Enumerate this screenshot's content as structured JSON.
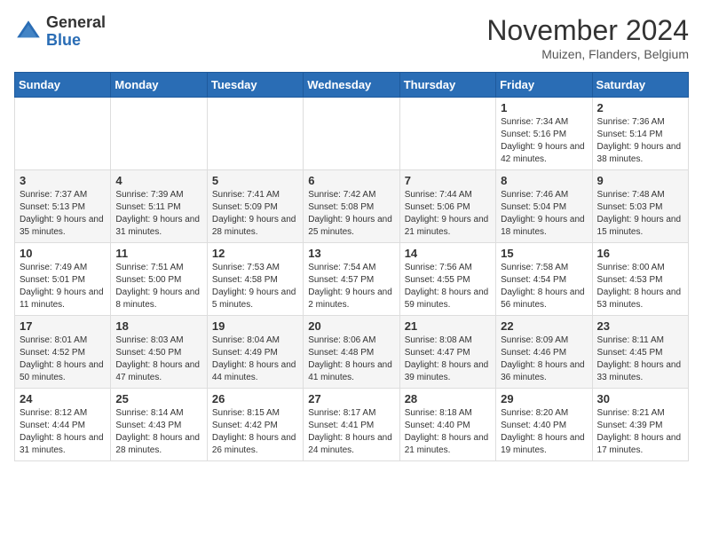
{
  "header": {
    "logo_general": "General",
    "logo_blue": "Blue",
    "month_title": "November 2024",
    "location": "Muizen, Flanders, Belgium"
  },
  "days_of_week": [
    "Sunday",
    "Monday",
    "Tuesday",
    "Wednesday",
    "Thursday",
    "Friday",
    "Saturday"
  ],
  "weeks": [
    [
      {
        "num": "",
        "info": ""
      },
      {
        "num": "",
        "info": ""
      },
      {
        "num": "",
        "info": ""
      },
      {
        "num": "",
        "info": ""
      },
      {
        "num": "",
        "info": ""
      },
      {
        "num": "1",
        "info": "Sunrise: 7:34 AM\nSunset: 5:16 PM\nDaylight: 9 hours and 42 minutes."
      },
      {
        "num": "2",
        "info": "Sunrise: 7:36 AM\nSunset: 5:14 PM\nDaylight: 9 hours and 38 minutes."
      }
    ],
    [
      {
        "num": "3",
        "info": "Sunrise: 7:37 AM\nSunset: 5:13 PM\nDaylight: 9 hours and 35 minutes."
      },
      {
        "num": "4",
        "info": "Sunrise: 7:39 AM\nSunset: 5:11 PM\nDaylight: 9 hours and 31 minutes."
      },
      {
        "num": "5",
        "info": "Sunrise: 7:41 AM\nSunset: 5:09 PM\nDaylight: 9 hours and 28 minutes."
      },
      {
        "num": "6",
        "info": "Sunrise: 7:42 AM\nSunset: 5:08 PM\nDaylight: 9 hours and 25 minutes."
      },
      {
        "num": "7",
        "info": "Sunrise: 7:44 AM\nSunset: 5:06 PM\nDaylight: 9 hours and 21 minutes."
      },
      {
        "num": "8",
        "info": "Sunrise: 7:46 AM\nSunset: 5:04 PM\nDaylight: 9 hours and 18 minutes."
      },
      {
        "num": "9",
        "info": "Sunrise: 7:48 AM\nSunset: 5:03 PM\nDaylight: 9 hours and 15 minutes."
      }
    ],
    [
      {
        "num": "10",
        "info": "Sunrise: 7:49 AM\nSunset: 5:01 PM\nDaylight: 9 hours and 11 minutes."
      },
      {
        "num": "11",
        "info": "Sunrise: 7:51 AM\nSunset: 5:00 PM\nDaylight: 9 hours and 8 minutes."
      },
      {
        "num": "12",
        "info": "Sunrise: 7:53 AM\nSunset: 4:58 PM\nDaylight: 9 hours and 5 minutes."
      },
      {
        "num": "13",
        "info": "Sunrise: 7:54 AM\nSunset: 4:57 PM\nDaylight: 9 hours and 2 minutes."
      },
      {
        "num": "14",
        "info": "Sunrise: 7:56 AM\nSunset: 4:55 PM\nDaylight: 8 hours and 59 minutes."
      },
      {
        "num": "15",
        "info": "Sunrise: 7:58 AM\nSunset: 4:54 PM\nDaylight: 8 hours and 56 minutes."
      },
      {
        "num": "16",
        "info": "Sunrise: 8:00 AM\nSunset: 4:53 PM\nDaylight: 8 hours and 53 minutes."
      }
    ],
    [
      {
        "num": "17",
        "info": "Sunrise: 8:01 AM\nSunset: 4:52 PM\nDaylight: 8 hours and 50 minutes."
      },
      {
        "num": "18",
        "info": "Sunrise: 8:03 AM\nSunset: 4:50 PM\nDaylight: 8 hours and 47 minutes."
      },
      {
        "num": "19",
        "info": "Sunrise: 8:04 AM\nSunset: 4:49 PM\nDaylight: 8 hours and 44 minutes."
      },
      {
        "num": "20",
        "info": "Sunrise: 8:06 AM\nSunset: 4:48 PM\nDaylight: 8 hours and 41 minutes."
      },
      {
        "num": "21",
        "info": "Sunrise: 8:08 AM\nSunset: 4:47 PM\nDaylight: 8 hours and 39 minutes."
      },
      {
        "num": "22",
        "info": "Sunrise: 8:09 AM\nSunset: 4:46 PM\nDaylight: 8 hours and 36 minutes."
      },
      {
        "num": "23",
        "info": "Sunrise: 8:11 AM\nSunset: 4:45 PM\nDaylight: 8 hours and 33 minutes."
      }
    ],
    [
      {
        "num": "24",
        "info": "Sunrise: 8:12 AM\nSunset: 4:44 PM\nDaylight: 8 hours and 31 minutes."
      },
      {
        "num": "25",
        "info": "Sunrise: 8:14 AM\nSunset: 4:43 PM\nDaylight: 8 hours and 28 minutes."
      },
      {
        "num": "26",
        "info": "Sunrise: 8:15 AM\nSunset: 4:42 PM\nDaylight: 8 hours and 26 minutes."
      },
      {
        "num": "27",
        "info": "Sunrise: 8:17 AM\nSunset: 4:41 PM\nDaylight: 8 hours and 24 minutes."
      },
      {
        "num": "28",
        "info": "Sunrise: 8:18 AM\nSunset: 4:40 PM\nDaylight: 8 hours and 21 minutes."
      },
      {
        "num": "29",
        "info": "Sunrise: 8:20 AM\nSunset: 4:40 PM\nDaylight: 8 hours and 19 minutes."
      },
      {
        "num": "30",
        "info": "Sunrise: 8:21 AM\nSunset: 4:39 PM\nDaylight: 8 hours and 17 minutes."
      }
    ]
  ]
}
